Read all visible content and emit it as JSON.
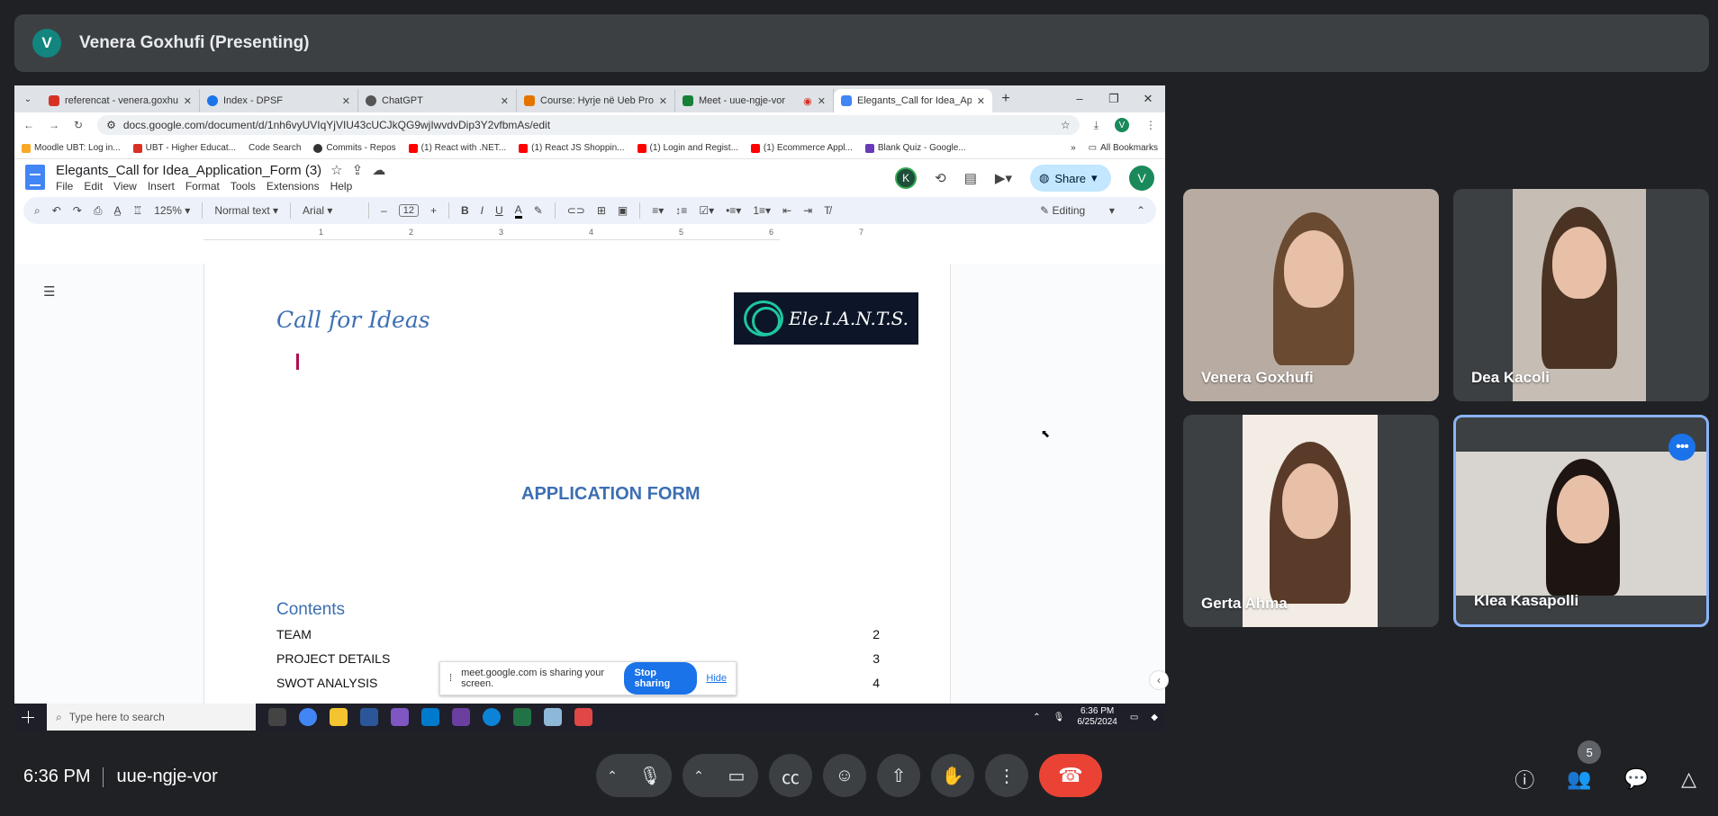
{
  "presenter": {
    "initial": "V",
    "label": "Venera Goxhufi (Presenting)"
  },
  "browser": {
    "tabs": [
      {
        "title": "referencat - venera.goxhufi",
        "color": "#d93025"
      },
      {
        "title": "Index - DPSF",
        "color": "#1a73e8"
      },
      {
        "title": "ChatGPT",
        "color": "#555555"
      },
      {
        "title": "Course: Hyrje në Ueb Prog",
        "color": "#e37400"
      },
      {
        "title": "Meet - uue-ngje-vor",
        "color": "#188038"
      },
      {
        "title": "Elegants_Call for Idea_App",
        "color": "#4285f4"
      }
    ],
    "url": "docs.google.com/document/d/1nh6vyUVIqYjVIU43cUCJkQG9wjIwvdvDip3Y2vfbmAs/edit",
    "bookmarks": [
      "Moodle UBT: Log in...",
      "UBT - Higher Educat...",
      "Code Search",
      "Commits - Repos",
      "(1) React with .NET...",
      "(1) React JS Shoppin...",
      "(1) Login and Regist...",
      "(1) Ecommerce Appl...",
      "Blank Quiz - Google..."
    ],
    "all_bookmarks": "All Bookmarks",
    "profile_initial": "V"
  },
  "docs": {
    "title": "Elegants_Call for Idea_Application_Form (3)",
    "menu": [
      "File",
      "Edit",
      "View",
      "Insert",
      "Format",
      "Tools",
      "Extensions",
      "Help"
    ],
    "collaborator_initial": "K",
    "share_label": "Share",
    "user_initial": "V",
    "toolbar": {
      "zoom": "125%",
      "style": "Normal text",
      "font": "Arial",
      "font_size": "12",
      "mode": "Editing"
    },
    "ruler": [
      "1",
      "2",
      "3",
      "4",
      "5",
      "6",
      "7"
    ],
    "page": {
      "heading": "Call for Ideas",
      "logo_text": "Ele.I.A.N.T.S.",
      "form_title": "APPLICATION FORM",
      "contents_heading": "Contents",
      "toc": [
        {
          "label": "TEAM",
          "page": "2"
        },
        {
          "label": "PROJECT DETAILS",
          "page": "3"
        },
        {
          "label": "SWOT ANALYSIS",
          "page": "4"
        }
      ]
    }
  },
  "share_notice": {
    "text": "meet.google.com is sharing your screen.",
    "stop": "Stop sharing",
    "hide": "Hide"
  },
  "taskbar": {
    "search_placeholder": "Type here to search",
    "time": "6:36 PM",
    "date": "6/25/2024"
  },
  "participants": [
    {
      "name": "Venera Goxhufi"
    },
    {
      "name": "Dea Kacoli"
    },
    {
      "name": "Gerta Ahma"
    },
    {
      "name": "Klea Kasapolli"
    }
  ],
  "meeting": {
    "time": "6:36 PM",
    "code": "uue-ngje-vor",
    "people_count": "5"
  }
}
